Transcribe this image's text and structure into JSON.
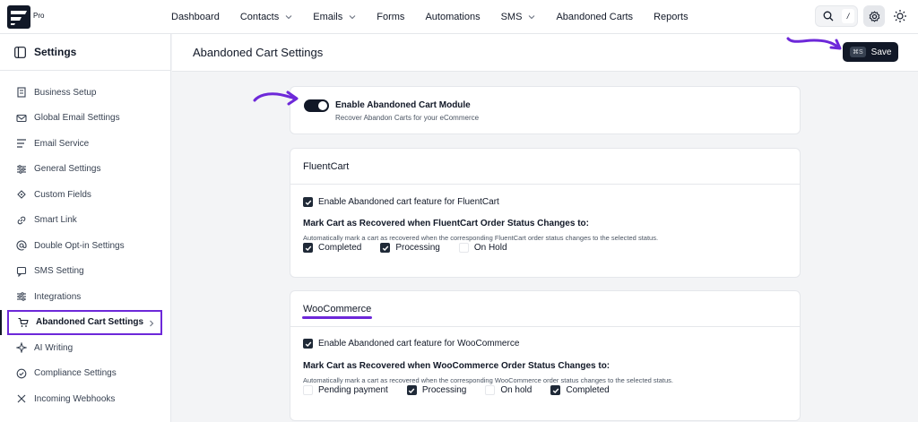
{
  "app": {
    "badge": "Pro"
  },
  "nav": {
    "items": [
      {
        "label": "Dashboard",
        "dropdown": false
      },
      {
        "label": "Contacts",
        "dropdown": true
      },
      {
        "label": "Emails",
        "dropdown": true
      },
      {
        "label": "Forms",
        "dropdown": false
      },
      {
        "label": "Automations",
        "dropdown": false
      },
      {
        "label": "SMS",
        "dropdown": true
      },
      {
        "label": "Abandoned Carts",
        "dropdown": false
      },
      {
        "label": "Reports",
        "dropdown": false
      }
    ],
    "search_shortcut": "/"
  },
  "sidebar": {
    "title": "Settings",
    "items": [
      {
        "label": "Business Setup",
        "icon": "building-icon"
      },
      {
        "label": "Global Email Settings",
        "icon": "mail-icon"
      },
      {
        "label": "Email Service",
        "icon": "send-icon"
      },
      {
        "label": "General Settings",
        "icon": "sliders-icon"
      },
      {
        "label": "Custom Fields",
        "icon": "fields-icon"
      },
      {
        "label": "Smart Link",
        "icon": "link-icon"
      },
      {
        "label": "Double Opt-in Settings",
        "icon": "at-icon"
      },
      {
        "label": "SMS Setting",
        "icon": "message-icon"
      },
      {
        "label": "Integrations",
        "icon": "plug-icon"
      },
      {
        "label": "Abandoned Cart Settings",
        "icon": "cart-icon",
        "active": true
      },
      {
        "label": "AI Writing",
        "icon": "sparkle-icon"
      },
      {
        "label": "Compliance Settings",
        "icon": "check-circle-icon"
      },
      {
        "label": "Incoming Webhooks",
        "icon": "webhook-icon"
      }
    ]
  },
  "main": {
    "title": "Abandoned Cart Settings",
    "save": {
      "shortcut": "⌘S",
      "label": "Save"
    },
    "module": {
      "enabled": true,
      "title": "Enable Abandoned Cart Module",
      "subtitle": "Recover Abandon Carts for your eCommerce"
    },
    "fluentcart": {
      "title": "FluentCart",
      "enable_label": "Enable Abandoned cart feature for FluentCart",
      "enable_checked": true,
      "status_title": "Mark Cart as Recovered when FluentCart Order Status Changes to:",
      "status_sub": "Automatically mark a cart as recovered when the corresponding FluentCart order status changes to the selected status.",
      "options": [
        {
          "label": "Completed",
          "checked": true
        },
        {
          "label": "Processing",
          "checked": true
        },
        {
          "label": "On Hold",
          "checked": false
        }
      ]
    },
    "woocommerce": {
      "title": "WooCommerce",
      "enable_label": "Enable Abandoned cart feature for WooCommerce",
      "enable_checked": true,
      "status_title": "Mark Cart as Recovered when WooCommerce Order Status Changes to:",
      "status_sub": "Automatically mark a cart as recovered when the corresponding WooCommerce order status changes to the selected status.",
      "options": [
        {
          "label": "Pending payment",
          "checked": false
        },
        {
          "label": "Processing",
          "checked": true
        },
        {
          "label": "On hold",
          "checked": false
        },
        {
          "label": "Completed",
          "checked": true
        }
      ]
    }
  },
  "colors": {
    "accent": "#6d28d9",
    "dark": "#111827"
  }
}
